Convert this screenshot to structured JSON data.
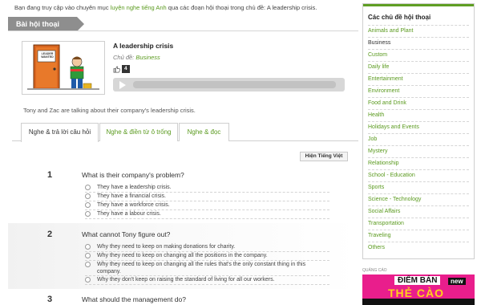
{
  "breadcrumb": {
    "before": "Bạn đang truy cập vào chuyên mục ",
    "link": "luyện nghe tiếng Anh",
    "after": " qua các đoạn hội thoại trong chủ đề: A leadership crisis."
  },
  "section_tab": "Bài hội thoại",
  "lesson": {
    "title": "A leadership crisis",
    "topic_label": "Chủ đề:",
    "topic_value": "Business",
    "like_count": "4",
    "description": "Tony and Zac are talking about their company's leadership crisis.",
    "thumb_sign": "LEADER WANTED"
  },
  "tabs": [
    "Nghe & trả lời câu hỏi",
    "Nghe & điền từ ô trống",
    "Nghe & đọc"
  ],
  "lang_button": "Hiện Tiếng Việt",
  "questions": [
    {
      "num": "1",
      "text": "What is their company's problem?",
      "options": [
        "They have a leadership crisis.",
        "They have a financial crisis.",
        "They have a workforce crisis.",
        "They have a labour crisis."
      ]
    },
    {
      "num": "2",
      "text": "What cannot Tony figure out?",
      "options": [
        "Why they need to keep on making donations for charity.",
        "Why they need to keep on changing all the positions in the company.",
        "Why they need to keep on changing all the rules that's the only constant thing in this company.",
        "Why they don't keep on raising the standard of living for all our workers."
      ]
    },
    {
      "num": "3",
      "text": "What should the management do?",
      "options": []
    }
  ],
  "sidebar": {
    "title": "Các chủ đề hội thoại",
    "items": [
      "Animals and Plant",
      "Business",
      "Custom",
      "Daily life",
      "Entertainment",
      "Environment",
      "Food and Drink",
      "Health",
      "Holidays and Events",
      "Job",
      "Mystery",
      "Relationship",
      "School - Education",
      "Sports",
      "Science - Technology",
      "Social Affairs",
      "Transportation",
      "Traveling",
      "Others"
    ],
    "current": "Business"
  },
  "ad": {
    "label": "QUẢNG CÁO",
    "logo": "ĐIỂM BÁN",
    "badge": "new",
    "main": "THẺ CÀO"
  },
  "colors": {
    "accent_green": "#5a9a1e",
    "sidebar_bar": "#5f9e24",
    "tab_gray": "#8e8e8e",
    "ad_pink": "#e91e8c"
  }
}
